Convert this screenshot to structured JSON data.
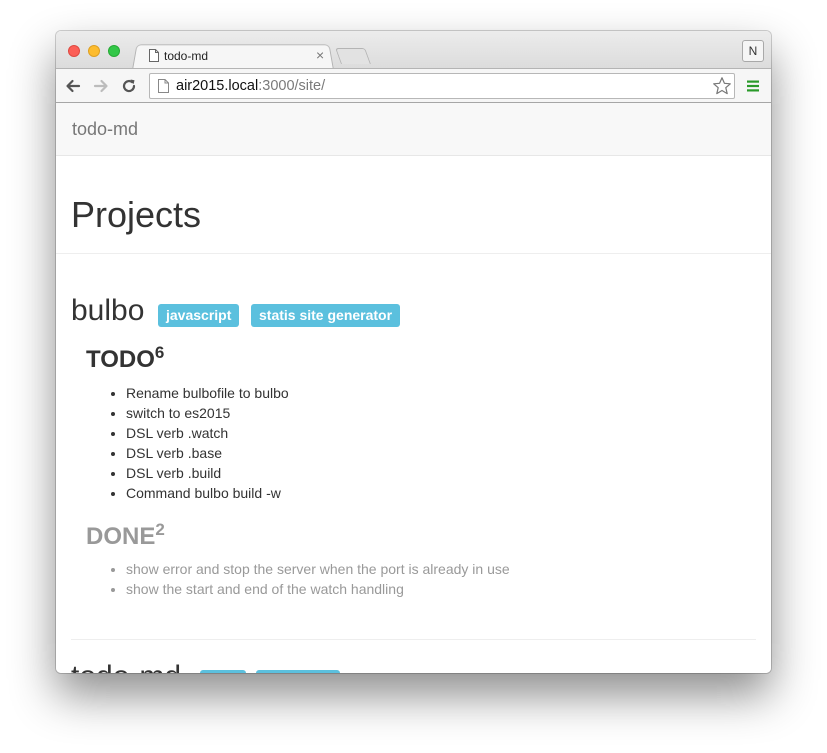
{
  "browser": {
    "tab_title": "todo-md",
    "tab_close": "×",
    "profile_initial": "N",
    "url_host": "air2015.local",
    "url_path": ":3000/site/",
    "menu_color": "#2a9a2a"
  },
  "site": {
    "brand": "todo-md",
    "page_title": "Projects"
  },
  "projects": [
    {
      "name": "bulbo",
      "tags": [
        "javascript",
        "statis site generator"
      ],
      "todo": {
        "label": "TODO",
        "count": "6",
        "items": [
          "Rename bulbofile to bulbo",
          "switch to es2015",
          "DSL verb .watch",
          "DSL verb .base",
          "DSL verb .build",
          "Command bulbo build -w"
        ]
      },
      "done": {
        "label": "DONE",
        "count": "2",
        "items": [
          "show error and stop the server when the port is already in use",
          "show the start and end of the watch handling"
        ]
      }
    },
    {
      "name": "todo-md"
    }
  ],
  "colors": {
    "label_bg": "#5bc0de",
    "text": "#333333",
    "muted": "#999999"
  }
}
